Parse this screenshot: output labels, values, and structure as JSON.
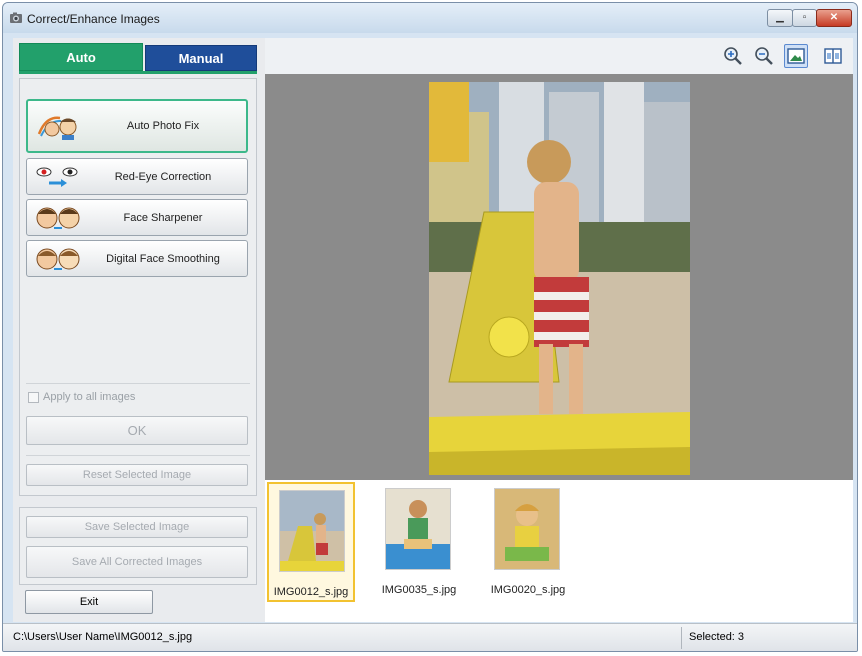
{
  "window": {
    "title": "Correct/Enhance Images"
  },
  "tabs": {
    "auto": "Auto",
    "manual": "Manual"
  },
  "functions": [
    {
      "label": "Auto Photo Fix",
      "icon": "auto-photo-fix-icon"
    },
    {
      "label": "Red-Eye Correction",
      "icon": "red-eye-icon"
    },
    {
      "label": "Face Sharpener",
      "icon": "face-sharpener-icon"
    },
    {
      "label": "Digital Face Smoothing",
      "icon": "face-smoothing-icon"
    }
  ],
  "options": {
    "apply_all_label": "Apply to all images",
    "ok_label": "OK",
    "reset_label": "Reset Selected Image"
  },
  "save": {
    "save_selected_label": "Save Selected Image",
    "save_all_label": "Save All Corrected Images"
  },
  "exit_label": "Exit",
  "toolbar": {
    "tools": [
      "zoom-in-icon",
      "zoom-out-icon",
      "whole-image-view-icon",
      "compare-view-icon"
    ]
  },
  "thumbnails": [
    {
      "caption": "IMG0012_s.jpg",
      "selected": true
    },
    {
      "caption": "IMG0035_s.jpg",
      "selected": false
    },
    {
      "caption": "IMG0020_s.jpg",
      "selected": false
    }
  ],
  "status": {
    "path": "C:\\Users\\User Name\\IMG0012_s.jpg",
    "selected": "Selected: 3"
  },
  "colors": {
    "auto_tab": "#22a06b",
    "manual_tab": "#1f4e9a",
    "selected_thumb_border": "#f2c230"
  }
}
